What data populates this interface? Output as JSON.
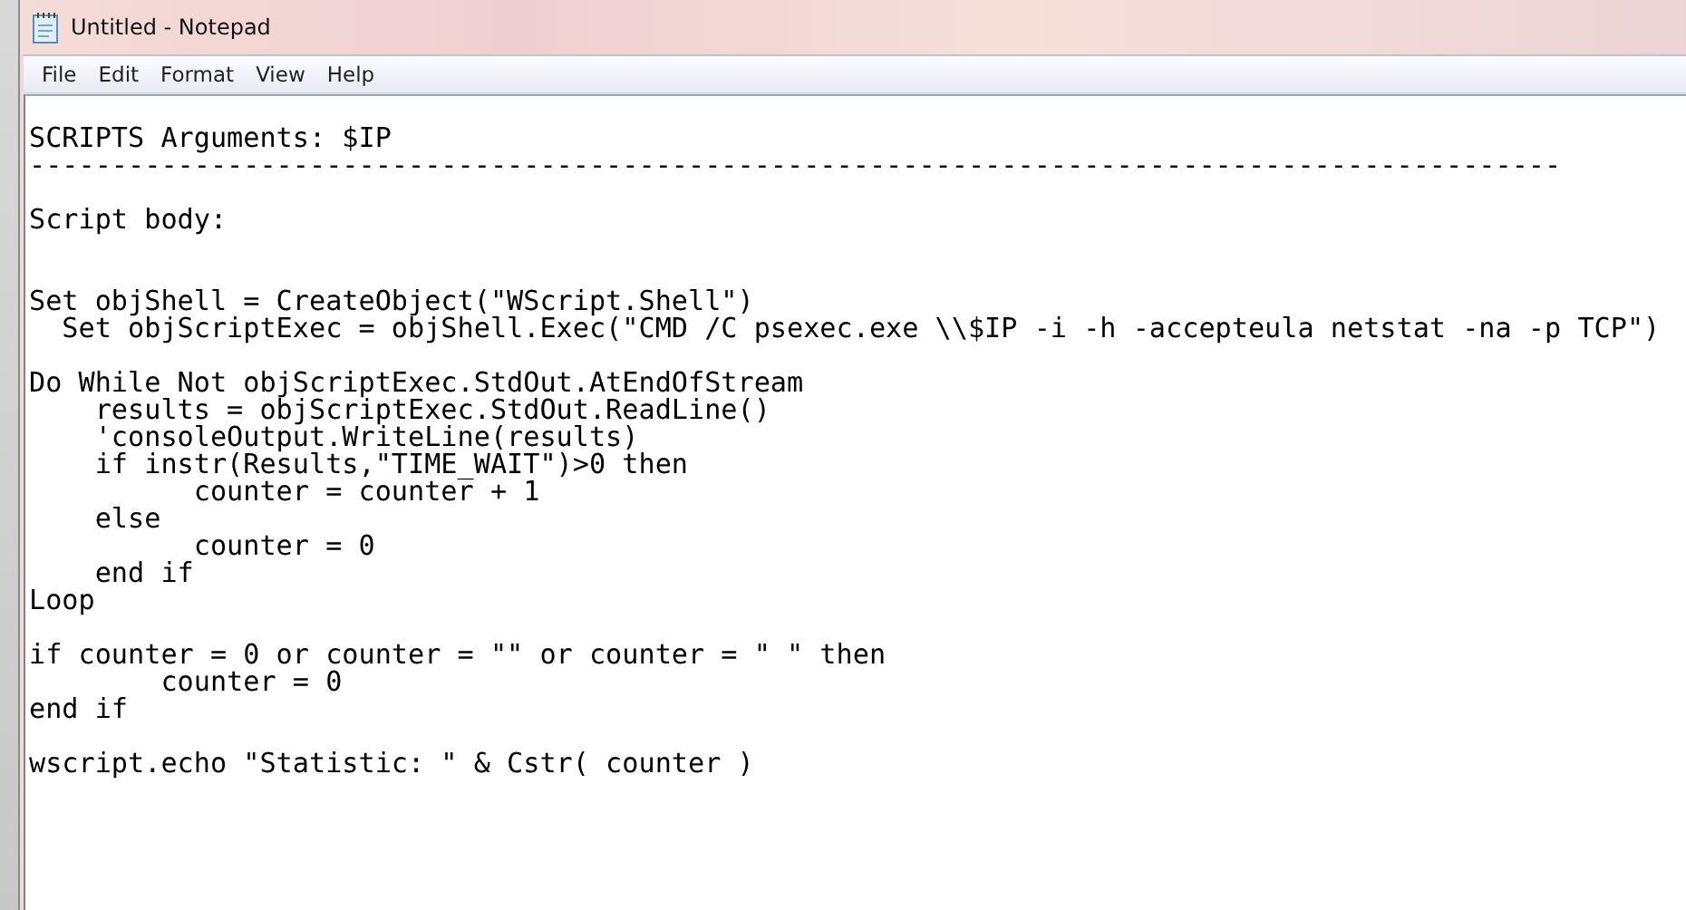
{
  "window": {
    "title": "Untitled - Notepad"
  },
  "menu": [
    "File",
    "Edit",
    "Format",
    "View",
    "Help"
  ],
  "editor": {
    "text": "\nSCRIPTS Arguments: $IP\n---------------------------------------------------------------------------------------------\n\nScript body:\n\n\nSet objShell = CreateObject(\"WScript.Shell\")\n  Set objScriptExec = objShell.Exec(\"CMD /C psexec.exe \\\\$IP -i -h -accepteula netstat -na -p TCP\")\n\nDo While Not objScriptExec.StdOut.AtEndOfStream\n    results = objScriptExec.StdOut.ReadLine()\n    'consoleOutput.WriteLine(results)\n    if instr(Results,\"TIME_WAIT\")>0 then\n          counter = counter + 1\n    else\n          counter = 0\n    end if\nLoop\n\nif counter = 0 or counter = \"\" or counter = \" \" then\n        counter = 0\nend if\n\nwscript.echo \"Statistic: \" & Cstr( counter )"
  }
}
